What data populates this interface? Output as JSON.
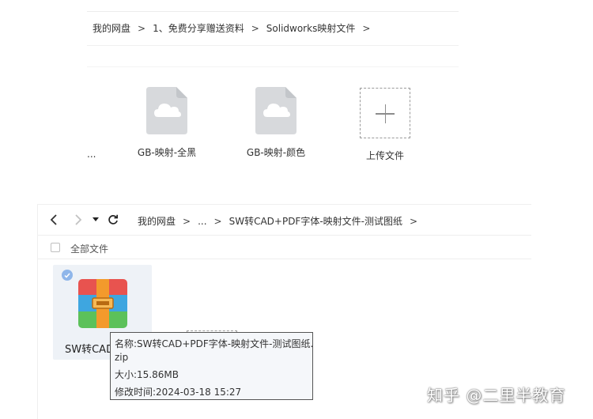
{
  "panel_top": {
    "breadcrumb": {
      "root": "我的网盘",
      "folder1": "1、免费分享赠送资料",
      "folder2": "Solidworks映射文件",
      "separator": ">"
    },
    "ellipsis": "...",
    "files": [
      {
        "name": "GB-映射-全黑",
        "icon": "cloud-file-icon"
      },
      {
        "name": "GB-映射-颜色",
        "icon": "cloud-file-icon"
      }
    ],
    "upload_label": "上传文件"
  },
  "panel_bottom": {
    "nav": {
      "back": "‹",
      "forward": "›",
      "dropdown": "▾",
      "refresh": "↻"
    },
    "breadcrumb": {
      "root": "我的网盘",
      "ellipsis": "...",
      "current": "SW转CAD+PDF字体-映射文件-测试图纸",
      "separator": ">"
    },
    "all_files_label": "全部文件",
    "selected_file": {
      "name": "SW转CAD",
      "icon": "zip-archive-icon"
    },
    "tooltip": {
      "name_line1": "名称:SW转CAD+PDF字体-映射文件-测试图纸.",
      "name_line2": "zip",
      "size": "大小:15.86MB",
      "modified": "修改时间:2024-03-18 15:27"
    }
  },
  "watermark": "知乎 @二里半教育",
  "colors": {
    "zip_red": "#e8534f",
    "zip_blue": "#3ea6e0",
    "zip_green": "#5cc15a",
    "zip_orange": "#f39a2c",
    "selection_bg": "#eef2f7",
    "check_blue": "#8fb6ea"
  }
}
